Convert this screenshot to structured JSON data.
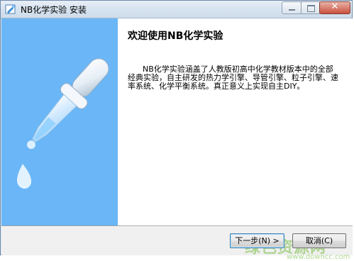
{
  "window": {
    "title": "NB化学实验 安装",
    "close_glyph": "✕"
  },
  "welcome": {
    "heading": "欢迎使用NB化学实验",
    "description": "      NB化学实验涵盖了人教版初高中化学教材版本中的全部经典实验，自主研发的热力学引擎、导管引擎、粒子引擎、速率系统、化学平衡系统。真正意义上实现自主DIY。"
  },
  "buttons": {
    "next_label": "下一步(N) >",
    "cancel_label": "取消(C)"
  },
  "watermark": {
    "text": "绿色资源网",
    "url": "www.downcc.com"
  },
  "icons": {
    "app": "installer-app-icon",
    "dropper": "dropper-illustration-icon"
  },
  "colors": {
    "side_panel": "#6ab6f6",
    "content_bg": "#ffffff",
    "window_bg": "#f0f0f0"
  }
}
